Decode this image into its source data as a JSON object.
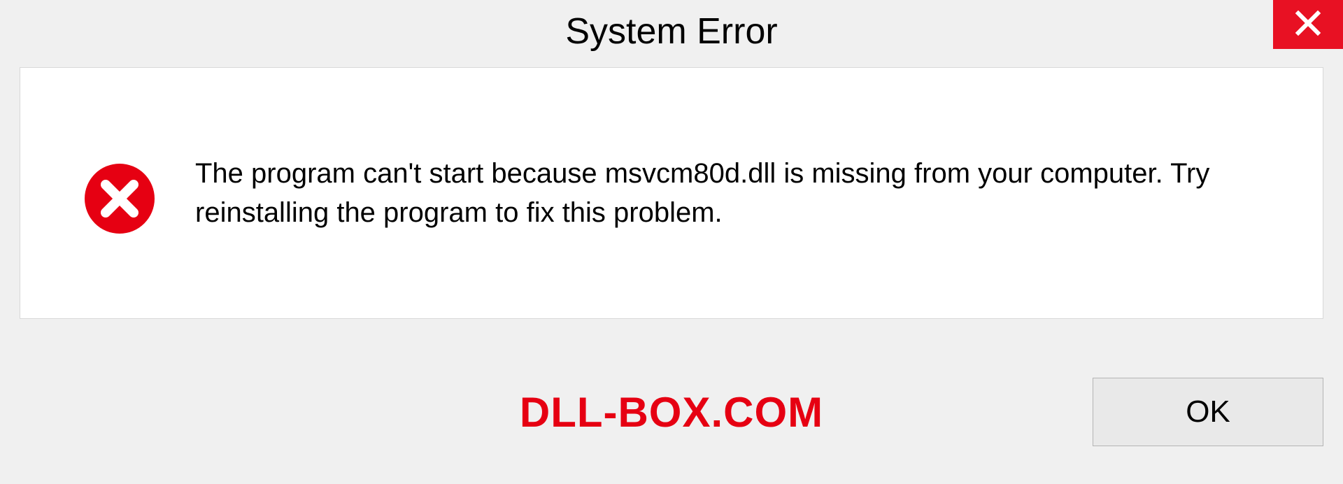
{
  "dialog": {
    "title": "System Error",
    "message": "The program can't start because msvcm80d.dll is missing from your computer. Try reinstalling the program to fix this problem.",
    "ok_label": "OK"
  },
  "watermark": "DLL-BOX.COM",
  "colors": {
    "close_bg": "#e81123",
    "error_icon": "#e60012",
    "watermark": "#e60012"
  }
}
